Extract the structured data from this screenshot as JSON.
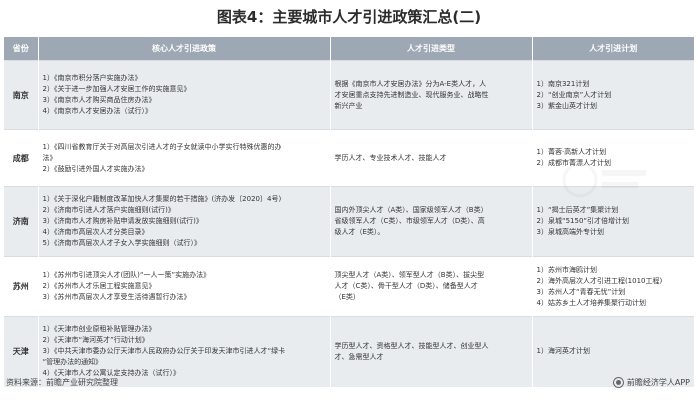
{
  "title": "图表4：主要城市人才引进政策汇总(二)",
  "headers": {
    "province": "省份",
    "policy": "核心人才引进政策",
    "talent_type": "人才引进类型",
    "plan": "人才引进计划"
  },
  "rows": [
    {
      "province": "南京",
      "policies": [
        "1）《南京市积分落户实施办法》",
        "2）《关于进一步加强人才安居工作的实施意见》",
        "3）《南京市人才购买商品住房办法》",
        "4）《南京市人才安居办法（试行）》"
      ],
      "talent_types": [
        "根据《南京市人才安居办法》分为A-E类人才，人",
        "才安居重点支持先进制造业、现代服务业、战略性",
        "新兴产业"
      ],
      "plans": [
        "1）南京321计划",
        "2）“创业南京”人才计划",
        "3）紫金山英才计划"
      ]
    },
    {
      "province": "成都",
      "policies": [
        "1）《四川省教育厅关于对高层次引进人才的子女就读中小学实行特殊优惠的办",
        "法》",
        "2）《鼓励引进外国人才实施办法》"
      ],
      "talent_types": [
        "学历人才、专业技术人才、技能人才"
      ],
      "plans": [
        "1）菁蓉·高新人才计划",
        "2）成都市菁漂人才计划"
      ]
    },
    {
      "province": "济南",
      "policies": [
        "1）《关于深化户籍制度改革加快人才集聚的若干措施》(济办发〔2020〕4号)",
        "2）《济南市引进人才落户实施细则(试行)》",
        "3）《济南市人才购房补贴申请发放实施细则(试行)》",
        "4）《济南市高层次人才分类目录》",
        "5）《济南市高层次人才子女入学实施细则（试行）》"
      ],
      "talent_types": [
        "国内外顶尖人才（A类）、国家级领军人才（B类）",
        "省级领军人才（C类）、市级领军人才（D类）、高",
        "级人才（E类）。"
      ],
      "plans": [
        "1）“揭士后英才”集聚计划",
        "2）泉城“5150”引才倍增计划",
        "3）泉城高端外专计划"
      ]
    },
    {
      "province": "苏州",
      "policies": [
        "1）《苏州市引进顶尖人才(团队)“一人一策”实施办法》",
        "2）《苏州市人才乐居工程实施意见》",
        "3）《苏州市高层次人才享受生活待遇暂行办法》"
      ],
      "talent_types": [
        "顶尖型人才（A类）、领军型人才（B类）、拔尖型",
        "人才（C类）、骨干型人才（D类）、储备型人才",
        "（E类）"
      ],
      "plans": [
        "1）苏州市海鸥计划",
        "2）海外高层次人才引进工程(1010工程)",
        "3）苏州人才“青春无忧”计划",
        "4）姑苏乡土人才培养集聚行动计划"
      ]
    },
    {
      "province": "天津",
      "policies": [
        "1）《天津市创业原租补贴管理办法》",
        "2）《天津市“海河英才”行动计划》",
        "3）《中共天津市委办公厅天津市人民政府办公厅关于印发天津市引进人才“绿卡",
        "“管理办法的通知》",
        "4）《天津市人才公寓认定支持办法（试行）》"
      ],
      "talent_types": [
        "学历型人才、资格型人才、技能型人才、创业型人",
        "才、急需型人才"
      ],
      "plans": [
        "1）海河英才计划"
      ]
    }
  ],
  "footer": {
    "source": "资料来源：前瞻产业研究院整理",
    "brand": "前瞻经济学人APP"
  }
}
